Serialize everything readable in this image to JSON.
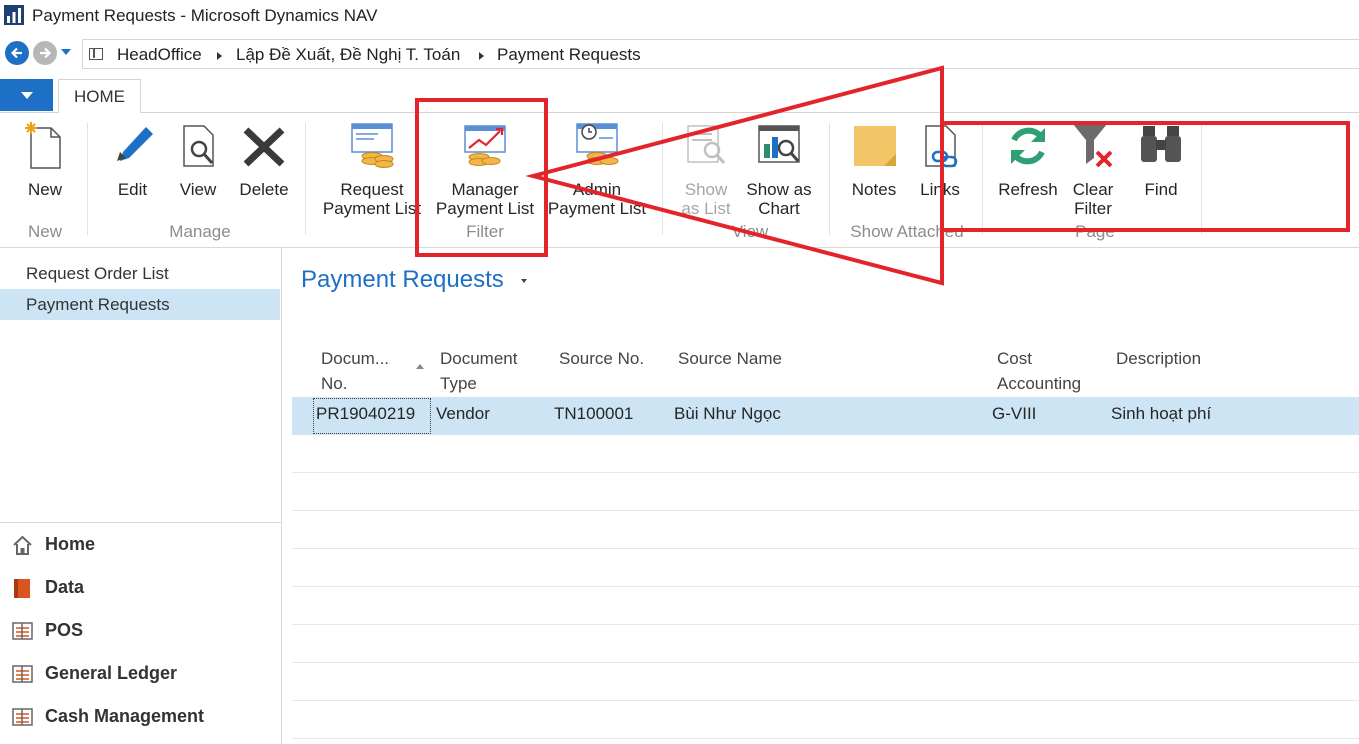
{
  "window": {
    "title": "Payment Requests - Microsoft Dynamics NAV"
  },
  "breadcrumb": [
    "HeadOffice",
    "Lập Đề Xuất, Đề Nghị T. Toán",
    "Payment Requests"
  ],
  "ribbon": {
    "tab": "HOME",
    "groups": {
      "new": "New",
      "manage": "Manage",
      "filter": "Filter",
      "view": "View",
      "show_attached": "Show Attached",
      "page": "Page"
    },
    "buttons": {
      "new": "New",
      "edit": "Edit",
      "view": "View",
      "delete": "Delete",
      "request_list_1": "Request",
      "request_list_2": "Payment List",
      "manager_list_1": "Manager",
      "manager_list_2": "Payment List",
      "admin_list_1": "Admin",
      "admin_list_2": "Payment List",
      "show_as_list_1": "Show",
      "show_as_list_2": "as List",
      "show_as_chart_1": "Show as",
      "show_as_chart_2": "Chart",
      "notes": "Notes",
      "links": "Links",
      "refresh": "Refresh",
      "clear_filter_1": "Clear",
      "clear_filter_2": "Filter",
      "find": "Find"
    }
  },
  "leftnav": {
    "items": [
      "Request Order List",
      "Payment Requests"
    ],
    "areas": [
      "Home",
      "Data",
      "POS",
      "General Ledger",
      "Cash Management"
    ]
  },
  "page": {
    "title": "Payment Requests"
  },
  "table": {
    "columns": {
      "doc_no_1": "Docum...",
      "doc_no_2": "No.",
      "doc_type_1": "Document",
      "doc_type_2": "Type",
      "source_no": "Source No.",
      "source_name": "Source Name",
      "cost_1": "Cost",
      "cost_2": "Accounting",
      "description": "Description"
    },
    "rows": [
      {
        "doc_no": "PR19040219",
        "doc_type": "Vendor",
        "source_no": "TN100001",
        "source_name": "Bùi Như Ngọc",
        "cost_accounting": "G-VIII",
        "description": "Sinh hoạt phí"
      }
    ]
  },
  "colors": {
    "accent": "#1e6fc6",
    "selection": "#cde4f5",
    "annotation": "#e3242b"
  }
}
